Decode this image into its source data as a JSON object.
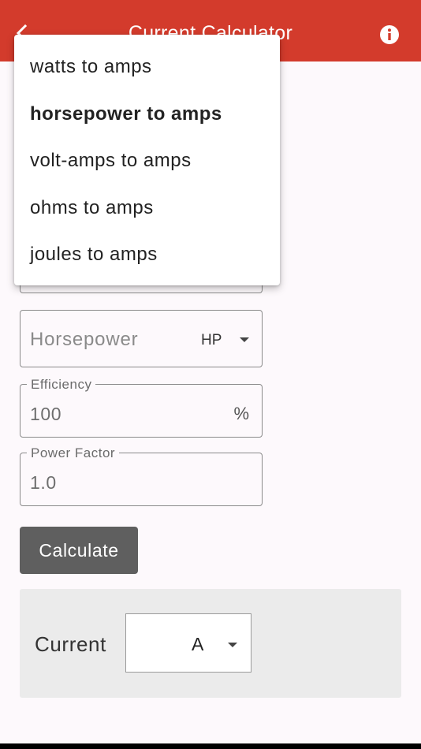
{
  "appbar": {
    "title": "Current Calculator",
    "back_icon": "back-arrow-icon",
    "info_icon": "info-icon"
  },
  "dropdown": {
    "items": [
      {
        "label": "watts to amps",
        "selected": false
      },
      {
        "label": "horsepower to amps",
        "selected": true
      },
      {
        "label": "volt-amps to amps",
        "selected": false
      },
      {
        "label": "ohms to amps",
        "selected": false
      },
      {
        "label": "joules to amps",
        "selected": false
      }
    ]
  },
  "form": {
    "horsepower": {
      "placeholder": "Horsepower",
      "unit": "HP"
    },
    "efficiency": {
      "label": "Efficiency",
      "value": "100",
      "suffix": "%"
    },
    "power_factor": {
      "label": "Power Factor",
      "value": "1.0"
    }
  },
  "calculate_label": "Calculate",
  "result": {
    "label": "Current",
    "unit": "A"
  },
  "colors": {
    "appbar": "#d33b2c",
    "button": "#5f5f5f",
    "result_bg": "#ebebeb"
  }
}
